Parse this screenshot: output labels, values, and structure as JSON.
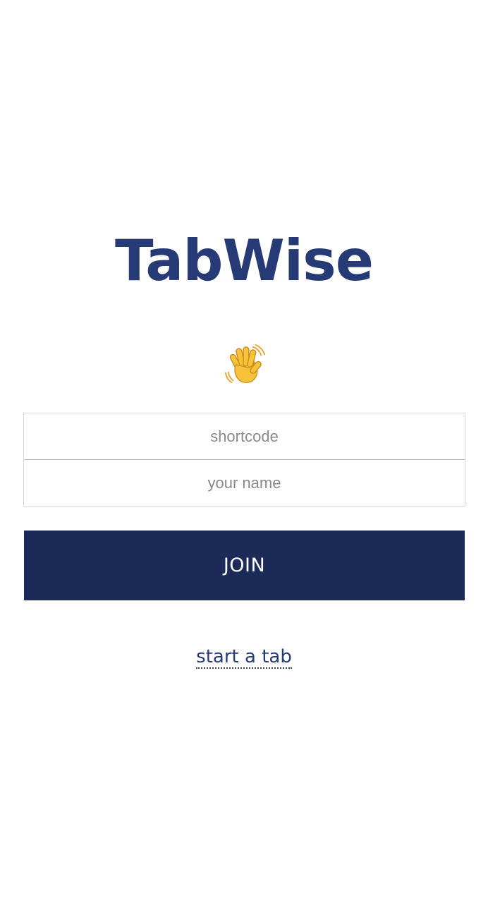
{
  "app": {
    "title": "TabWise"
  },
  "greeting": {
    "icon": "waving-hand-icon"
  },
  "form": {
    "shortcode": {
      "value": "",
      "placeholder": "shortcode"
    },
    "name": {
      "value": "",
      "placeholder": "your name"
    },
    "join_label": "JOIN"
  },
  "links": {
    "start_tab": "start a tab"
  },
  "colors": {
    "brand": "#263a75",
    "button_bg": "#1c2a58",
    "button_text": "#ffffff",
    "placeholder": "#8a8a8a",
    "border": "#d9d9d9"
  }
}
